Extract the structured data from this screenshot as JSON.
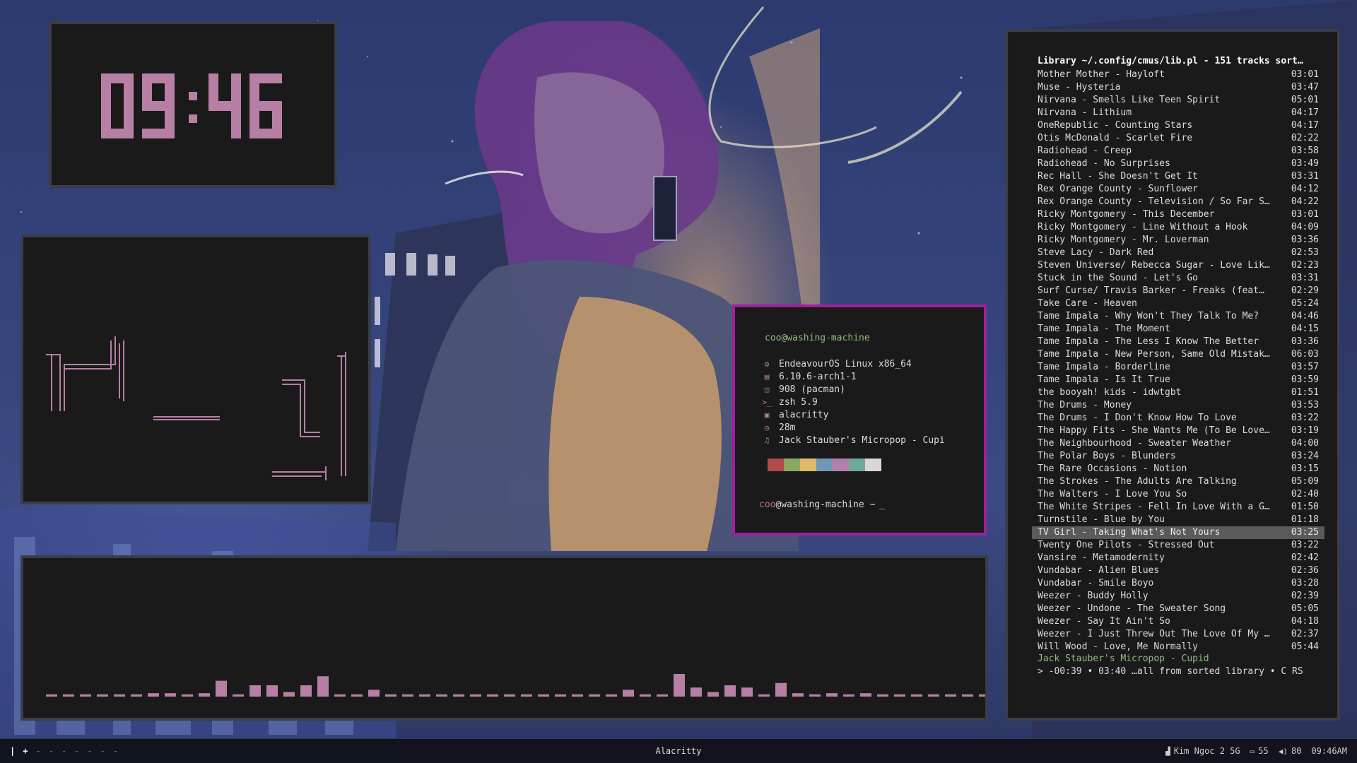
{
  "clock": {
    "hours": "09",
    "colon": ":",
    "minutes": "46",
    "color": "#b87fa6"
  },
  "fetch": {
    "user": "coo@washing-machine",
    "rows": [
      {
        "icon": "gear-icon",
        "glyph": "⚙",
        "text": "EndeavourOS Linux x86_64"
      },
      {
        "icon": "chip-icon",
        "glyph": "▤",
        "text": "6.10.6-arch1-1"
      },
      {
        "icon": "package-icon",
        "glyph": "◫",
        "text": "908 (pacman)"
      },
      {
        "icon": "shell-icon",
        "glyph": ">_",
        "text": "zsh 5.9"
      },
      {
        "icon": "terminal-icon",
        "glyph": "▣",
        "text": "alacritty"
      },
      {
        "icon": "clock-icon",
        "glyph": "◷",
        "text": "28m"
      },
      {
        "icon": "music-icon",
        "glyph": "♫",
        "text": "Jack Stauber's Micropop - Cupi"
      }
    ],
    "swatches": [
      "#b24a4a",
      "#8aa866",
      "#e0b86a",
      "#6f98b4",
      "#b47fa8",
      "#6fa89c",
      "#d8d8d8"
    ],
    "prompt": {
      "user": "coo",
      "host": "@washing-machine",
      "path": "~",
      "cursor": "_"
    }
  },
  "cmus": {
    "header": "Library ~/.config/cmus/lib.pl - 151 tracks sort…",
    "tracks": [
      {
        "title": "Mother Mother - Hayloft",
        "duration": "03:01"
      },
      {
        "title": "Muse - Hysteria",
        "duration": "03:47"
      },
      {
        "title": "Nirvana - Smells Like Teen Spirit",
        "duration": "05:01"
      },
      {
        "title": "Nirvana - Lithium",
        "duration": "04:17"
      },
      {
        "title": "OneRepublic - Counting Stars",
        "duration": "04:17"
      },
      {
        "title": "Otis McDonald - Scarlet Fire",
        "duration": "02:22"
      },
      {
        "title": "Radiohead - Creep",
        "duration": "03:58"
      },
      {
        "title": "Radiohead - No Surprises",
        "duration": "03:49"
      },
      {
        "title": "Rec Hall - She Doesn't Get It",
        "duration": "03:31"
      },
      {
        "title": "Rex Orange County - Sunflower",
        "duration": "04:12"
      },
      {
        "title": "Rex Orange County - Television / So Far S…",
        "duration": "04:22"
      },
      {
        "title": "Ricky Montgomery - This December",
        "duration": "03:01"
      },
      {
        "title": "Ricky Montgomery - Line Without a Hook",
        "duration": "04:09"
      },
      {
        "title": "Ricky Montgomery - Mr. Loverman",
        "duration": "03:36"
      },
      {
        "title": "Steve Lacy - Dark Red",
        "duration": "02:53"
      },
      {
        "title": "Steven Universe/ Rebecca Sugar - Love Lik…",
        "duration": "02:23"
      },
      {
        "title": "Stuck in the Sound - Let's Go",
        "duration": "03:31"
      },
      {
        "title": "Surf Curse/ Travis Barker - Freaks (feat…",
        "duration": "02:29"
      },
      {
        "title": "Take Care - Heaven",
        "duration": "05:24"
      },
      {
        "title": "Tame Impala - Why Won't They Talk To Me?",
        "duration": "04:46"
      },
      {
        "title": "Tame Impala - The Moment",
        "duration": "04:15"
      },
      {
        "title": "Tame Impala - The Less I Know The Better",
        "duration": "03:36"
      },
      {
        "title": "Tame Impala - New Person, Same Old Mistak…",
        "duration": "06:03"
      },
      {
        "title": "Tame Impala - Borderline",
        "duration": "03:57"
      },
      {
        "title": "Tame Impala - Is It True",
        "duration": "03:59"
      },
      {
        "title": "the booyah! kids - idwtgbt",
        "duration": "01:51"
      },
      {
        "title": "The Drums - Money",
        "duration": "03:53"
      },
      {
        "title": "The Drums - I Don't Know How To Love",
        "duration": "03:22"
      },
      {
        "title": "The Happy Fits - She Wants Me (To Be Love…",
        "duration": "03:19"
      },
      {
        "title": "The Neighbourhood - Sweater Weather",
        "duration": "04:00"
      },
      {
        "title": "The Polar Boys - Blunders",
        "duration": "03:24"
      },
      {
        "title": "The Rare Occasions - Notion",
        "duration": "03:15"
      },
      {
        "title": "The Strokes - The Adults Are Talking",
        "duration": "05:09"
      },
      {
        "title": "The Walters - I Love You So",
        "duration": "02:40"
      },
      {
        "title": "The White Stripes - Fell In Love With a G…",
        "duration": "01:50"
      },
      {
        "title": "Turnstile - Blue by You",
        "duration": "01:18"
      },
      {
        "title": "TV Girl - Taking What's Not Yours",
        "duration": "03:25",
        "selected": true
      },
      {
        "title": "Twenty One Pilots - Stressed Out",
        "duration": "03:22"
      },
      {
        "title": "Vansire - Metamodernity",
        "duration": "02:42"
      },
      {
        "title": "Vundabar - Alien Blues",
        "duration": "02:36"
      },
      {
        "title": "Vundabar - Smile Boyo",
        "duration": "03:28"
      },
      {
        "title": "Weezer - Buddy Holly",
        "duration": "02:39"
      },
      {
        "title": "Weezer - Undone - The Sweater Song",
        "duration": "05:05"
      },
      {
        "title": "Weezer - Say It Ain't So",
        "duration": "04:18"
      },
      {
        "title": "Weezer - I Just Threw Out The Love Of My …",
        "duration": "02:37"
      },
      {
        "title": "Will Wood - Love, Me Normally",
        "duration": "05:44"
      }
    ],
    "now_playing": "Jack Stauber's Micropop - Cupid",
    "status": "> -00:39 • 03:40 …all from sorted library • C RS"
  },
  "visualizer": {
    "color": "#b87fa6",
    "levels": [
      0.04,
      0.04,
      0.04,
      0.04,
      0.04,
      0.04,
      0.06,
      0.06,
      0.04,
      0.06,
      0.28,
      0.04,
      0.2,
      0.2,
      0.08,
      0.2,
      0.36,
      0.04,
      0.04,
      0.12,
      0.04,
      0.04,
      0.04,
      0.04,
      0.04,
      0.04,
      0.04,
      0.04,
      0.04,
      0.04,
      0.04,
      0.04,
      0.04,
      0.04,
      0.12,
      0.04,
      0.04,
      0.4,
      0.16,
      0.08,
      0.2,
      0.16,
      0.04,
      0.24,
      0.06,
      0.04,
      0.06,
      0.04,
      0.06,
      0.04,
      0.04,
      0.04,
      0.04,
      0.04,
      0.04,
      0.04
    ]
  },
  "bar": {
    "workspaces": [
      {
        "label": "|",
        "state": "active"
      },
      {
        "label": "+",
        "state": "active"
      },
      {
        "label": "-",
        "state": "dim"
      },
      {
        "label": "-",
        "state": "dim"
      },
      {
        "label": "-",
        "state": "dim"
      },
      {
        "label": "-",
        "state": "dim"
      },
      {
        "label": "-",
        "state": "dim"
      },
      {
        "label": "-",
        "state": "dim"
      },
      {
        "label": "-",
        "state": "dim"
      }
    ],
    "window_title": "Alacritty",
    "wifi": "Kim Ngoc 2 5G",
    "battery": "55",
    "volume": "80",
    "time": "09:46AM"
  }
}
